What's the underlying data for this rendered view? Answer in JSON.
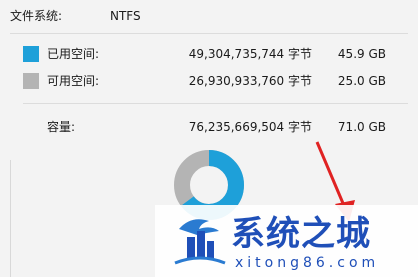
{
  "filesystem": {
    "label": "文件系统:",
    "value": "NTFS"
  },
  "used": {
    "label": "已用空间:",
    "bytes": "49,304,735,744 字节",
    "size": "45.9 GB",
    "color": "#1ea0d9"
  },
  "free": {
    "label": "可用空间:",
    "bytes": "26,930,933,760 字节",
    "size": "25.0 GB",
    "color": "#b4b4b4"
  },
  "capacity": {
    "label": "容量:",
    "bytes": "76,235,669,504 字节",
    "size": "71.0 GB"
  },
  "donut": {
    "used_fraction": 0.647
  },
  "watermark": {
    "title": "系统之城",
    "subtitle": "xitong86.com"
  }
}
